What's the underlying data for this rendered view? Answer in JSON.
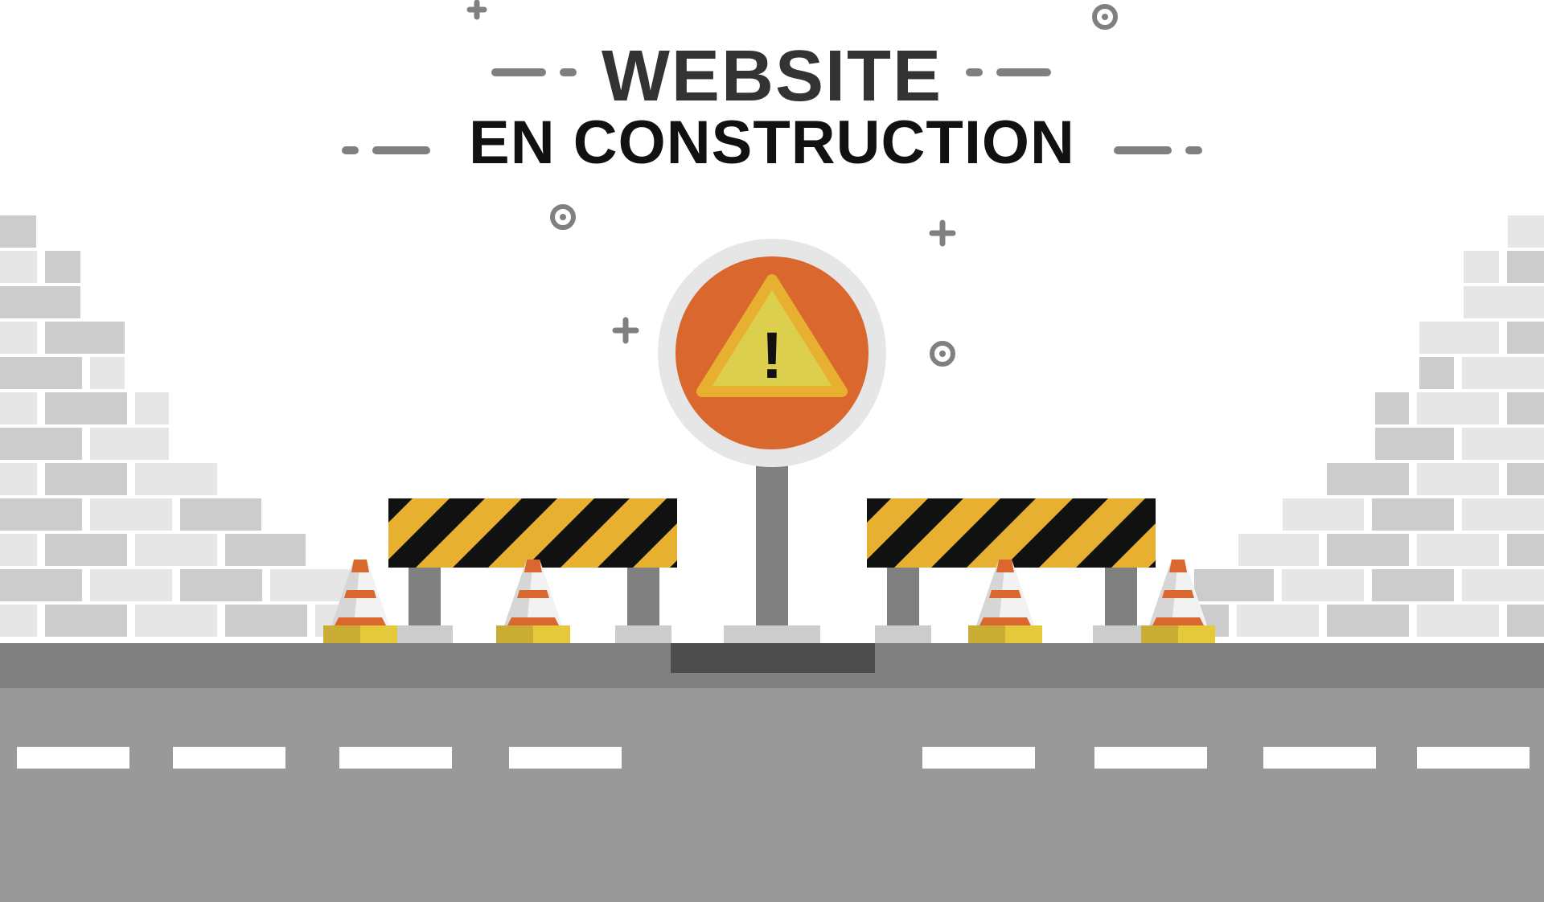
{
  "heading": {
    "line1": "WEBSITE",
    "line2": "EN CONSTRUCTION"
  },
  "sign": {
    "symbol": "!",
    "icon": "warning-triangle-icon"
  },
  "colors": {
    "background": "#ffffff",
    "sign_ring": "#e6e6e6",
    "sign_disc": "#d9672e",
    "triangle_border": "#e8b030",
    "triangle_fill": "#ddcf4e",
    "barrier_yellow": "#e8b030",
    "barrier_black": "#111111",
    "cone_orange": "#d9672e",
    "cone_base": "#e6c93a",
    "brick_light": "#e6e6e6",
    "brick_dark": "#cccccc",
    "road": "#999999",
    "road_edge": "#808080",
    "lane_mark": "#ffffff",
    "decor": "#808080"
  }
}
